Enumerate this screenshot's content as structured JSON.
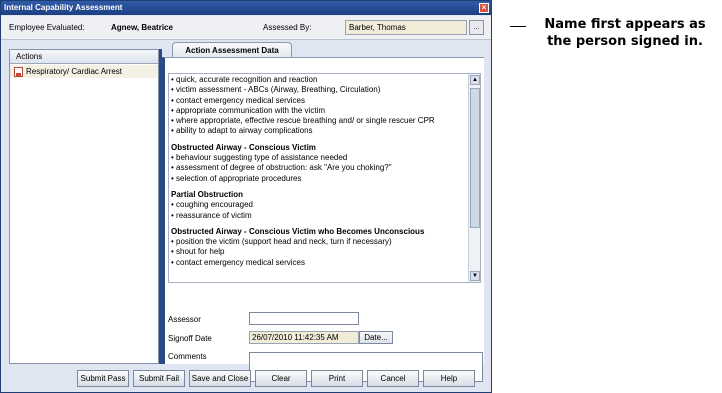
{
  "window": {
    "title": "Internal Capability Assessment",
    "close": "×"
  },
  "header": {
    "employee_label": "Employee Evaluated:",
    "employee_value": "Agnew, Beatrice",
    "assessed_label": "Assessed By:",
    "assessed_value": "Barber, Thomas",
    "browse_label": "..."
  },
  "actions": {
    "header": "Actions",
    "items": [
      {
        "label": "Respiratory/ Cardiac Arrest",
        "icon": "document-icon"
      }
    ]
  },
  "tab": {
    "label": "Action Assessment Data"
  },
  "content": {
    "lines": [
      {
        "text": "• quick, accurate recognition and reaction",
        "type": "bullet"
      },
      {
        "text": "• victim assessment - ABCs (Airway, Breathing, Circulation)",
        "type": "bullet"
      },
      {
        "text": "• contact emergency medical services",
        "type": "bullet"
      },
      {
        "text": "• appropriate communication with the victim",
        "type": "bullet"
      },
      {
        "text": "• where appropriate, effective rescue breathing and/ or single rescuer CPR",
        "type": "bullet"
      },
      {
        "text": "• ability to adapt to airway complications",
        "type": "bullet"
      },
      {
        "text": "",
        "type": "gap"
      },
      {
        "text": "Obstructed Airway - Conscious Victim",
        "type": "heading"
      },
      {
        "text": "• behaviour suggesting type of assistance needed",
        "type": "bullet"
      },
      {
        "text": "• assessment of degree of obstruction:  ask \"Are you choking?\"",
        "type": "bullet"
      },
      {
        "text": "• selection of appropriate procedures",
        "type": "bullet"
      },
      {
        "text": "",
        "type": "gap"
      },
      {
        "text": "Partial Obstruction",
        "type": "heading"
      },
      {
        "text": "• coughing encouraged",
        "type": "bullet"
      },
      {
        "text": "• reassurance of victim",
        "type": "bullet"
      },
      {
        "text": "",
        "type": "gap"
      },
      {
        "text": "Obstructed Airway - Conscious Victim who Becomes Unconscious",
        "type": "heading"
      },
      {
        "text": "• position the victim (support head and neck, turn if necessary)",
        "type": "bullet"
      },
      {
        "text": "• shout for help",
        "type": "bullet"
      },
      {
        "text": "• contact emergency medical services",
        "type": "bullet"
      }
    ]
  },
  "form": {
    "assessor_label": "Assessor",
    "assessor_value": "",
    "signoff_label": "Signoff Date",
    "signoff_value": "26/07/2010 11:42:35 AM",
    "date_button": "Date...",
    "comments_label": "Comments",
    "comments_value": ""
  },
  "buttons": [
    "Submit Pass",
    "Submit Fail",
    "Save and Close",
    "Clear",
    "Print",
    "Cancel",
    "Help"
  ],
  "annotation": {
    "text": "Name first appears as the person signed in."
  }
}
